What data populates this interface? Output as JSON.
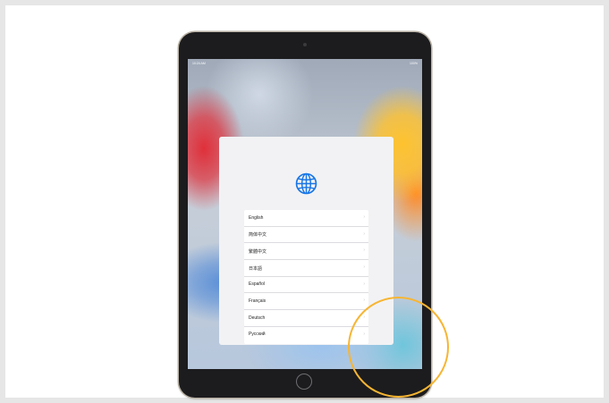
{
  "status_bar": {
    "time": "10:24 AM",
    "right": "100%"
  },
  "setup": {
    "icon": "globe-icon",
    "languages": [
      "English",
      "简体中文",
      "繁體中文",
      "日本語",
      "Español",
      "Français",
      "Deutsch",
      "Русский"
    ]
  },
  "colors": {
    "accent": "#1877e6",
    "highlight": "#f7b533"
  }
}
